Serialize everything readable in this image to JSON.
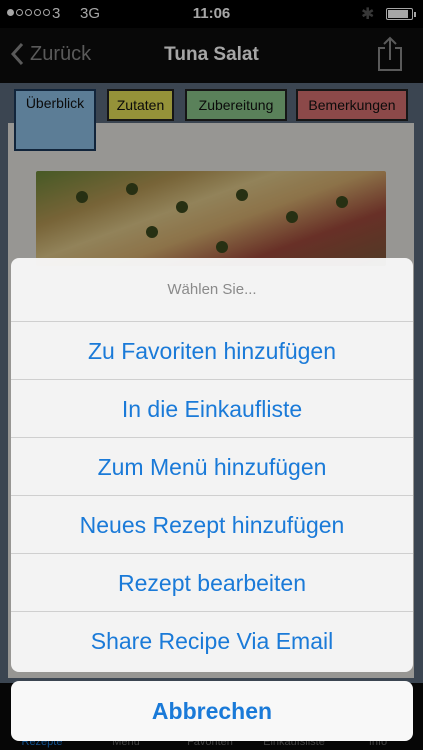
{
  "status_bar": {
    "carrier": "3",
    "network": "3G",
    "time": "11:06",
    "battery_level": 0.85
  },
  "nav": {
    "back_label": "Zurück",
    "title": "Tuna Salat"
  },
  "tabs": [
    {
      "label": "Überblick",
      "color": "#8ec0e6"
    },
    {
      "label": "Zutaten",
      "color": "#e5e058"
    },
    {
      "label": "Zubereitung",
      "color": "#8bc78b"
    },
    {
      "label": "Bemerkungen",
      "color": "#d87070"
    }
  ],
  "action_sheet": {
    "title": "Wählen Sie...",
    "options": [
      "Zu Favoriten hinzufügen",
      "In die Einkaufliste",
      "Zum Menü hinzufügen",
      "Neues Rezept hinzufügen",
      "Rezept bearbeiten",
      "Share Recipe Via Email"
    ],
    "cancel": "Abbrechen"
  },
  "tab_bar": [
    {
      "label": "Rezepte",
      "active": true
    },
    {
      "label": "Menü"
    },
    {
      "label": "Favoriten"
    },
    {
      "label": "Einkaufsliste"
    },
    {
      "label": "Info"
    }
  ],
  "colors": {
    "accent": "#1a7ad8"
  }
}
